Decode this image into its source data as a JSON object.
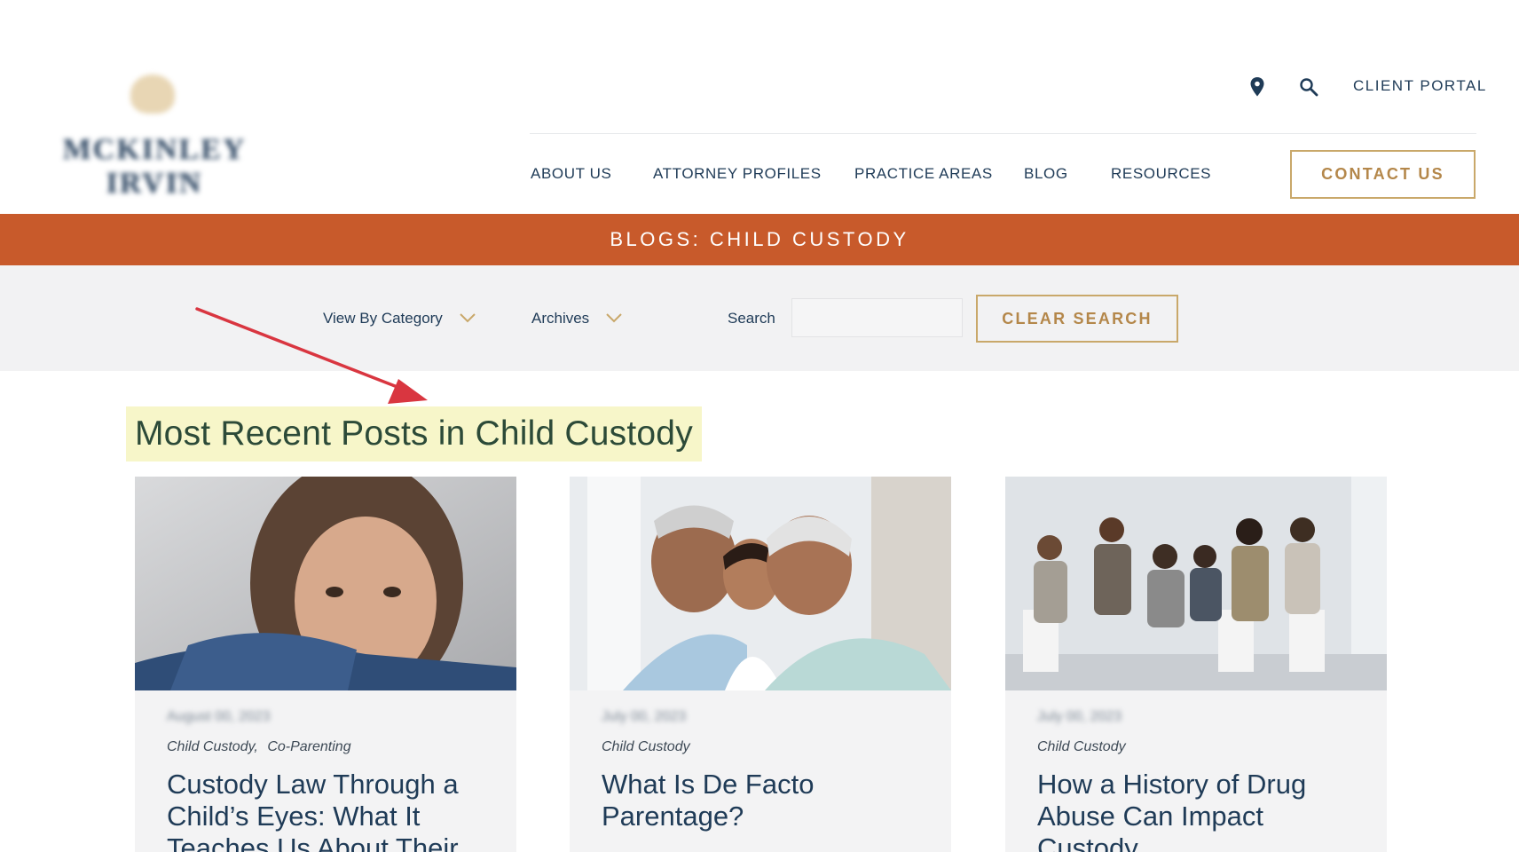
{
  "header": {
    "client_portal": "CLIENT PORTAL",
    "nav": {
      "about": "ABOUT US",
      "attorney": "ATTORNEY PROFILES",
      "practice": "PRACTICE AREAS",
      "blog": "BLOG",
      "resources": "RESOURCES"
    },
    "contact_label": "CONTACT US",
    "icons": [
      "location-pin-icon",
      "search-icon"
    ]
  },
  "banner": {
    "title": "BLOGS: CHILD CUSTODY"
  },
  "filters": {
    "category_label": "View By Category",
    "archives_label": "Archives",
    "search_label": "Search",
    "search_value": "",
    "clear_label": "CLEAR SEARCH"
  },
  "section": {
    "heading": "Most Recent Posts in Child Custody"
  },
  "colors": {
    "accent": "#c85a2b",
    "gold": "#c9a86a",
    "navy": "#1f3b57",
    "highlight": "#f7f6c9",
    "annotation": "#d93640"
  },
  "posts": [
    {
      "categories": [
        "Child Custody,",
        "Co-Parenting"
      ],
      "title": "Custody Law Through a Child’s Eyes: What It Teaches Us About Their"
    },
    {
      "categories": [
        "Child Custody"
      ],
      "title": "What Is De Facto Parentage?"
    },
    {
      "categories": [
        "Child Custody"
      ],
      "title": "How a History of Drug Abuse Can Impact Custody"
    }
  ]
}
